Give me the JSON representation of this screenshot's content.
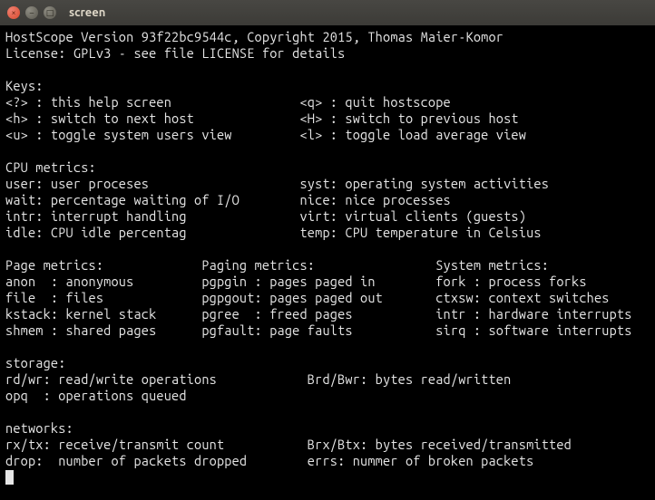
{
  "window": {
    "title": "screen"
  },
  "header": {
    "line1": "HostScope Version 93f22bc9544c, Copyright 2015, Thomas Maier-Komor",
    "line2": "License: GPLv3 - see file LICENSE for details"
  },
  "keys": {
    "heading": "Keys:",
    "rows": [
      {
        "l_key": "<?>",
        "l_desc": "this help screen",
        "r_key": "<q>",
        "r_desc": "quit hostscope"
      },
      {
        "l_key": "<h>",
        "l_desc": "switch to next host",
        "r_key": "<H>",
        "r_desc": "switch to previous host"
      },
      {
        "l_key": "<u>",
        "l_desc": "toggle system users view",
        "r_key": "<l>",
        "r_desc": "toggle load average view"
      }
    ]
  },
  "cpu": {
    "heading": "CPU metrics:",
    "rows": [
      {
        "l_key": "user:",
        "l_desc": "user proceses",
        "r_key": "syst:",
        "r_desc": "operating system activities"
      },
      {
        "l_key": "wait:",
        "l_desc": "percentage waiting of I/O",
        "r_key": "nice:",
        "r_desc": "nice processes"
      },
      {
        "l_key": "intr:",
        "l_desc": "interrupt handling",
        "r_key": "virt:",
        "r_desc": "virtual clients (guests)"
      },
      {
        "l_key": "idle:",
        "l_desc": "CPU idle percentag",
        "r_key": "temp:",
        "r_desc": "CPU temperature in Celsius"
      }
    ]
  },
  "metrics3": {
    "headings": {
      "c1": "Page metrics:",
      "c2": "Paging metrics:",
      "c3": "System metrics:"
    },
    "rows": [
      {
        "c1k": "anon  ",
        "c1d": "anonymous",
        "c2k": "pgpgin ",
        "c2d": "pages paged in",
        "c3k": "fork ",
        "c3d": "process forks"
      },
      {
        "c1k": "file  ",
        "c1d": "files",
        "c2k": "pgpgout",
        "c2d": "pages paged out",
        "c3k": "ctxsw",
        "c3d": "context switches"
      },
      {
        "c1k": "kstack",
        "c1d": "kernel stack",
        "c2k": "pgree  ",
        "c2d": "freed pages",
        "c3k": "intr ",
        "c3d": "hardware interrupts"
      },
      {
        "c1k": "shmem ",
        "c1d": "shared pages",
        "c2k": "pgfault",
        "c2d": "page faults",
        "c3k": "sirq ",
        "c3d": "software interrupts"
      }
    ]
  },
  "storage": {
    "heading": "storage:",
    "rows": [
      {
        "l_key": "rd/wr:",
        "l_desc": "read/write operations",
        "r_key": "Brd/Bwr:",
        "r_desc": "bytes read/written"
      },
      {
        "l_key": "opq  :",
        "l_desc": "operations queued",
        "r_key": "",
        "r_desc": ""
      }
    ]
  },
  "networks": {
    "heading": "networks:",
    "rows": [
      {
        "l_key": "rx/tx:",
        "l_desc": "receive/transmit count",
        "r_key": "Brx/Btx:",
        "r_desc": "bytes received/transmitted"
      },
      {
        "l_key": "drop: ",
        "l_desc": "number of packets dropped",
        "r_key": "errs:",
        "r_desc": "nummer of broken packets"
      }
    ]
  }
}
